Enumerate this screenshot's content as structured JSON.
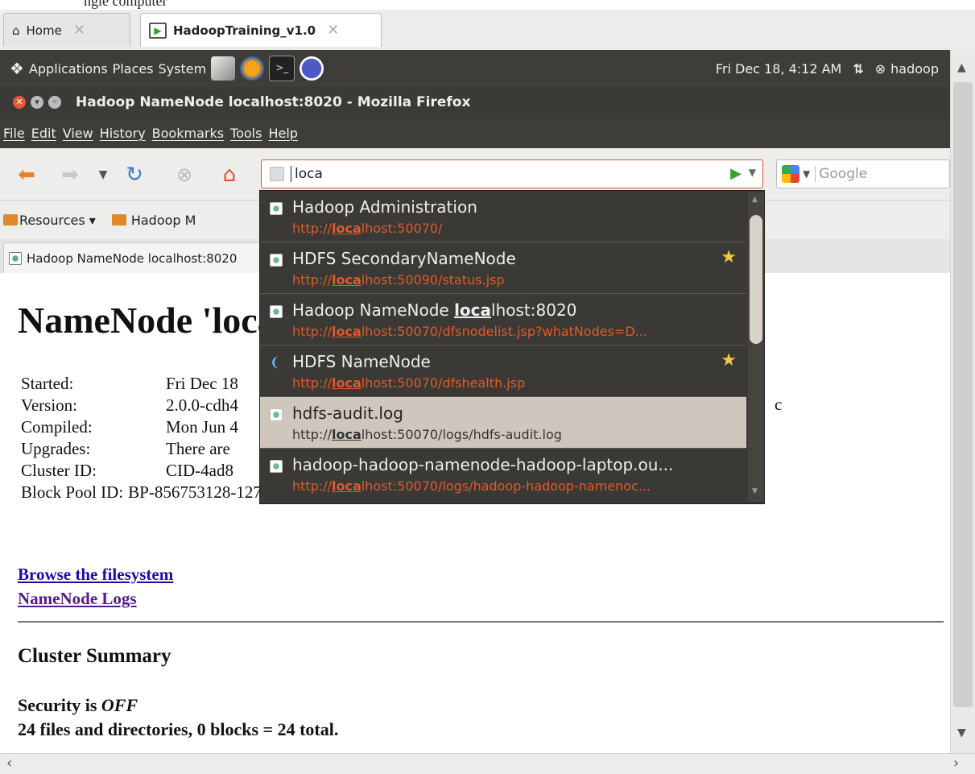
{
  "top_fragment": "ngle computer",
  "host_tabs": [
    {
      "label": "Home"
    },
    {
      "label": "HadoopTraining_v1.0"
    }
  ],
  "panel": {
    "applications": "Applications",
    "places": "Places",
    "system": "System",
    "datetime": "Fri Dec 18,  4:12 AM",
    "user": "hadoop"
  },
  "window_title": "Hadoop NameNode localhost:8020 - Mozilla Firefox",
  "menu": [
    "File",
    "Edit",
    "View",
    "History",
    "Bookmarks",
    "Tools",
    "Help"
  ],
  "urlbar_value": "loca",
  "search_placeholder": "Google",
  "bookmarks": {
    "resources": "Resources ▾",
    "hadoop": "Hadoop M"
  },
  "page_tab": "Hadoop NameNode localhost:8020",
  "page": {
    "heading": "NameNode 'localhost:8020' (active)",
    "info": [
      {
        "k": "Started:",
        "v": "Fri Dec 18"
      },
      {
        "k": "Version:",
        "v": "2.0.0-cdh4"
      },
      {
        "k": "Compiled:",
        "v": "Mon Jun 4"
      },
      {
        "k": "Upgrades:",
        "v": "There are"
      },
      {
        "k": "Cluster ID:",
        "v": "CID-4ad8"
      },
      {
        "k": "Block Pool ID:",
        "v": "BP-856753128-127.0.0.1-1608010607959"
      }
    ],
    "info_suffix": "c",
    "link_browse": "Browse the filesystem",
    "link_logs": "NameNode Logs",
    "cluster_heading": "Cluster Summary",
    "security_prefix": "Security is ",
    "security_state": "OFF",
    "files_line": "24 files and directories, 0 blocks = 24 total."
  },
  "autocomplete": [
    {
      "title": "Hadoop Administration",
      "url_pre": "http://",
      "url_hl": "loca",
      "url_post": "lhost:50070/",
      "star": false,
      "selected": false
    },
    {
      "title": "HDFS SecondaryNameNode",
      "url_pre": "http://",
      "url_hl": "loca",
      "url_post": "lhost:50090/status.jsp",
      "star": true,
      "selected": false
    },
    {
      "title": "Hadoop NameNode localhost:8020",
      "url_pre": "http://",
      "url_hl": "loca",
      "url_post": "lhost:50070/dfsnodelist.jsp?whatNodes=D...",
      "star": false,
      "selected": false
    },
    {
      "title": "HDFS NameNode",
      "url_pre": "http://",
      "url_hl": "loca",
      "url_post": "lhost:50070/dfshealth.jsp",
      "star": true,
      "selected": false
    },
    {
      "title": "hdfs-audit.log",
      "url_pre": "http://",
      "url_hl": "loca",
      "url_post": "lhost:50070/logs/hdfs-audit.log",
      "star": false,
      "selected": true
    },
    {
      "title": "hadoop-hadoop-namenode-hadoop-laptop.ou...",
      "url_pre": "http://",
      "url_hl": "loca",
      "url_post": "lhost:50070/logs/hadoop-hadoop-namenoc...",
      "star": false,
      "selected": false
    }
  ],
  "colors": {
    "accent_url": "#e05a2a",
    "panel": "#3e3d39",
    "link": "#1a0dab",
    "visited": "#551a8b"
  }
}
